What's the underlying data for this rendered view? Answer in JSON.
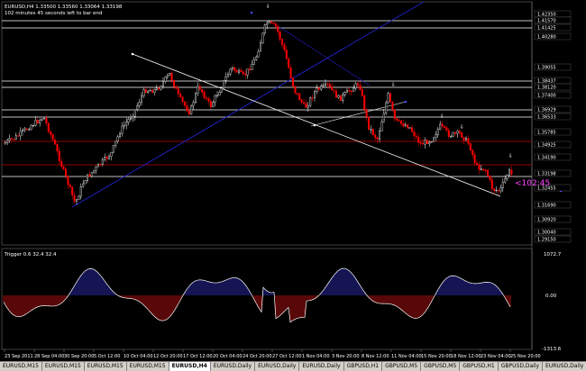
{
  "info": {
    "symbol_line": "EURUSD,H4  1.33500 1.33560 1.33064 1.33198",
    "bar_status": "102 minutes 45 seconds left to bar end"
  },
  "timer": "<102:45",
  "indicator": {
    "title": "Trigger 0.6 32.4 32.4",
    "top_label": "1072.7",
    "zero_label": "0.00",
    "bottom_label": "-1313.6"
  },
  "colors": {
    "price_up": "#ffffff",
    "price_down": "#ff0000",
    "support_line": "#c00000",
    "trend_blue": "#2222cc",
    "trend_white": "#ffffff",
    "timer_color": "#ff44ff",
    "osc_positive": "#2a2aa8",
    "osc_negative": "#b01010",
    "osc_line": "#ffffff"
  },
  "price_axis": [
    "1.42350",
    "1.41570",
    "1.41425",
    "1.40280",
    "1.39055",
    "1.38437",
    "1.38120",
    "1.37400",
    "1.36929",
    "1.36533",
    "1.35785",
    "1.34925",
    "1.34190",
    "1.33198",
    "1.32455",
    "1.31690",
    "1.30920",
    "1.30040",
    "1.29150"
  ],
  "time_axis": [
    "23 Sep 2011",
    "28 Sep 04:00",
    "30 Sep 20:00",
    "5 Oct 12:00",
    "10 Oct 04:00",
    "12 Oct 20:00",
    "17 Oct 12:00",
    "20 Oct 04:00",
    "24 Oct 20:00",
    "27 Oct 12:00",
    "1 Nov 04:00",
    "3 Nov 20:00",
    "8 Nov 12:00",
    "11 Nov 04:00",
    "15 Nov 20:00",
    "18 Nov 12:00",
    "23 Nov 04:00",
    "25 Nov 20:00"
  ],
  "tabs": [
    "EURUSD,M15",
    "EURUSD,M15",
    "EURUSD,M15",
    "EURUSD,M15",
    "EURUSD,H4",
    "EURUSD,Daily",
    "EURUSD,Daily",
    "EURUSD,Daily",
    "GBPUSD,H1",
    "GBPUSD,M5",
    "GBPUSD,M5",
    "GBPUSD,H1",
    "GBPUSD,Daily",
    "EURUSD,Daily",
    "EURUSD,Dai"
  ],
  "active_tab": 4
}
